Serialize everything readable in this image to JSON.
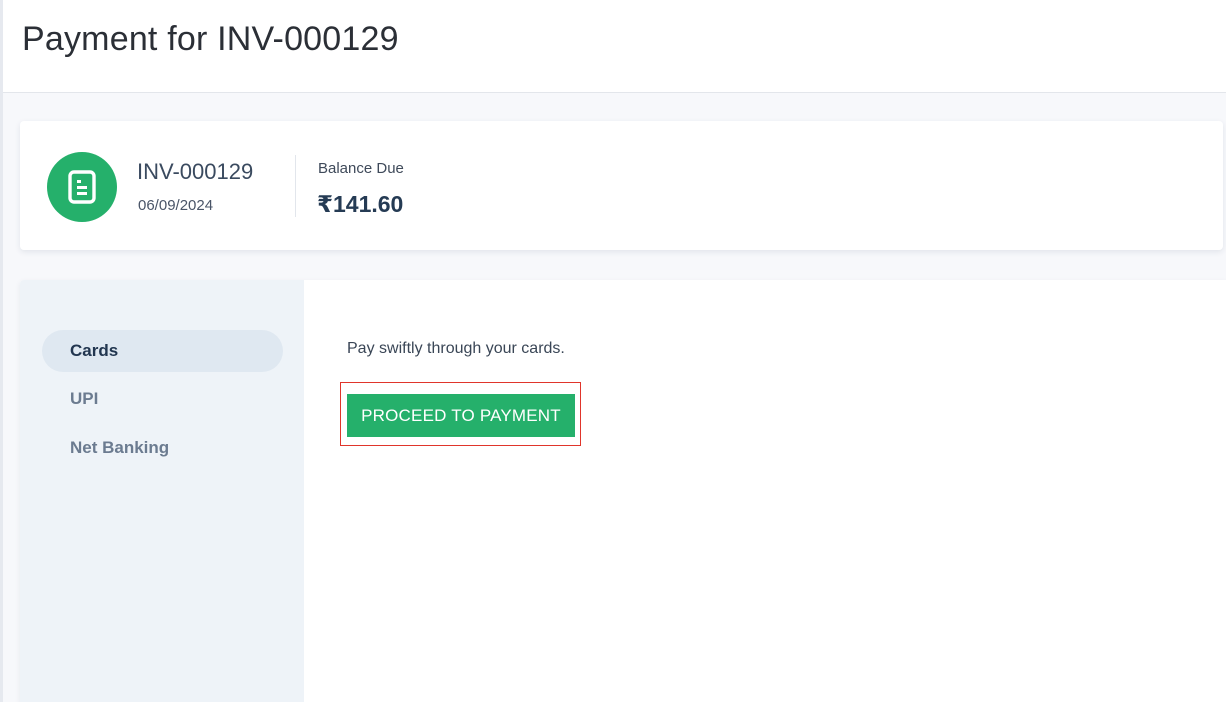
{
  "page": {
    "title": "Payment for INV-000129"
  },
  "invoice": {
    "icon": "document-icon",
    "number": "INV-000129",
    "date": "06/09/2024",
    "balance_label": "Balance Due",
    "balance_amount": "₹141.60"
  },
  "payment_methods": {
    "items": [
      {
        "label": "Cards",
        "active": true
      },
      {
        "label": "UPI",
        "active": false
      },
      {
        "label": "Net Banking",
        "active": false
      }
    ]
  },
  "cards_tab": {
    "description": "Pay swiftly through your cards.",
    "proceed_label": "PROCEED TO PAYMENT"
  },
  "colors": {
    "accent_green": "#25b06b",
    "highlight_red": "#e0352b",
    "active_tab_bg": "#dfe8f1"
  }
}
